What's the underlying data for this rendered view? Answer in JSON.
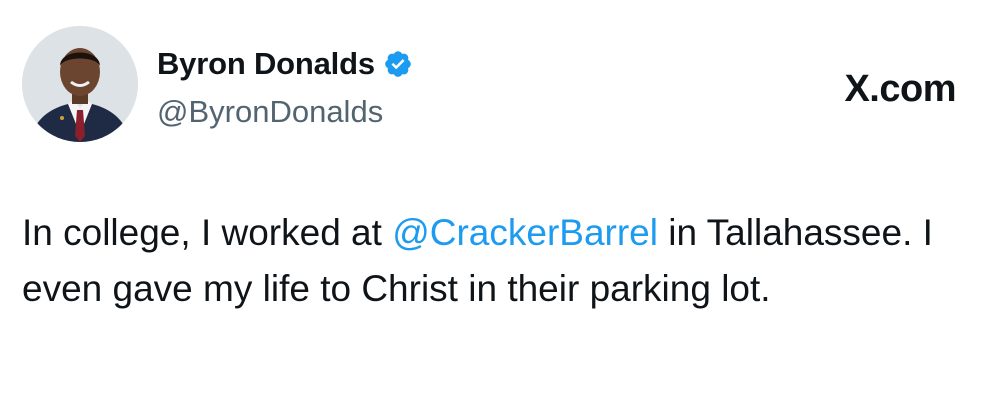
{
  "tweet": {
    "author": {
      "display_name": "Byron Donalds",
      "handle": "@ByronDonalds",
      "verified": true
    },
    "source_label": "X.com",
    "text_parts": {
      "before_mention": "In college, I worked at ",
      "mention": "@CrackerBarrel",
      "after_mention": " in Tallahassee. I even gave my life to Christ in their parking lot."
    }
  },
  "colors": {
    "text": "#0f1419",
    "secondary": "#536471",
    "accent": "#1d9bf0"
  },
  "icons": {
    "verified": "verified-badge-icon",
    "avatar": "profile-photo"
  }
}
